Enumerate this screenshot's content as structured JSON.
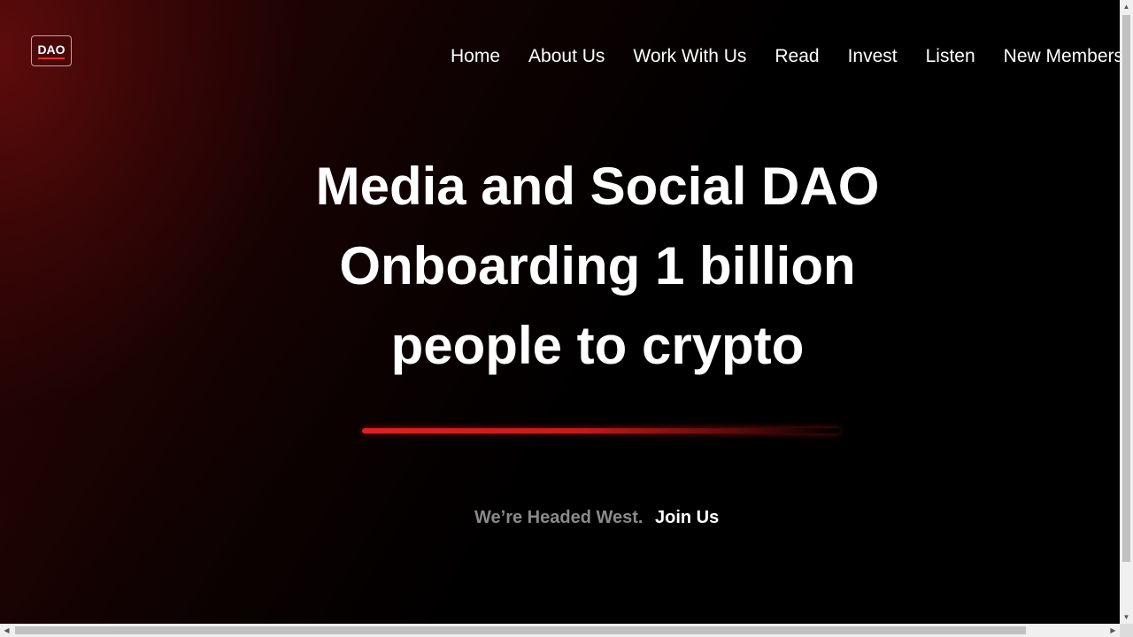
{
  "logo": {
    "text": "DAO"
  },
  "nav": {
    "items": [
      {
        "label": "Home"
      },
      {
        "label": "About Us"
      },
      {
        "label": "Work With Us"
      },
      {
        "label": "Read"
      },
      {
        "label": "Invest"
      },
      {
        "label": "Listen"
      },
      {
        "label": "New Members"
      }
    ]
  },
  "hero": {
    "lines": [
      "Media and Social DAO",
      "Onboarding 1 billion",
      "people to crypto"
    ]
  },
  "cta": {
    "tagline": "We’re Headed West.",
    "link_label": "Join Us"
  },
  "colors": {
    "accent": "#e02020",
    "background": "#000000",
    "muted_text": "#8a8a8a"
  },
  "scrollbars": {
    "arrow_up_icon": "triangle-up-icon",
    "arrow_down_icon": "triangle-down-icon",
    "arrow_left_icon": "triangle-left-icon",
    "arrow_right_icon": "triangle-right-icon"
  }
}
